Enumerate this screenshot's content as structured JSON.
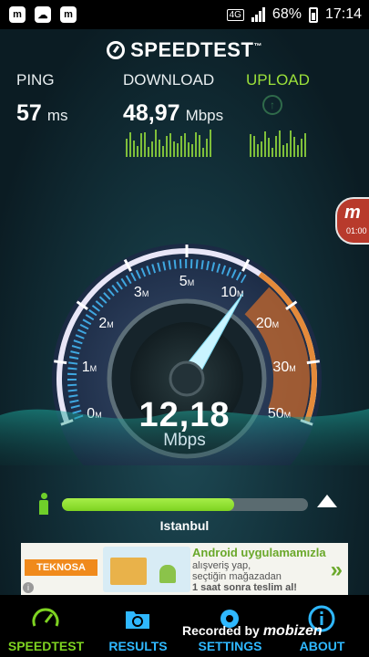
{
  "status_bar": {
    "network": "4G",
    "battery": "68%",
    "time": "17:14",
    "notification_icons": [
      "mobizen-icon",
      "cloud-upload-icon",
      "mobizen-icon"
    ]
  },
  "app": {
    "title": "SPEEDTEST",
    "trademark": "™"
  },
  "metrics": {
    "ping_label": "PING",
    "ping_value": "57",
    "ping_unit": "ms",
    "download_label": "DOWNLOAD",
    "download_value": "48,97",
    "download_unit": "Mbps",
    "upload_label": "UPLOAD"
  },
  "gauge": {
    "ticks": [
      "0",
      "1",
      "2",
      "3",
      "5",
      "10",
      "20",
      "30",
      "50"
    ],
    "tick_suffix": "M",
    "current_speed": "12,18",
    "unit": "Mbps",
    "needle_value": 12.18
  },
  "server": {
    "progress_fraction": 0.7,
    "city": "Istanbul"
  },
  "ad": {
    "brand": "TEKNOSA",
    "line1": "Android uygulamamızla",
    "line2": "alışveriş yap,",
    "line3": "seçtiğin mağazadan",
    "line4": "1 saat sonra teslim al!",
    "arrow": "»"
  },
  "overlay": {
    "mobizen_letter": "m",
    "mobizen_timer": "01:00",
    "recorded_by": "Recorded by",
    "recorder_brand": "mobizen"
  },
  "tabs": [
    {
      "label": "SPEEDTEST",
      "icon": "speedometer-icon",
      "active": true
    },
    {
      "label": "RESULTS",
      "icon": "folder-icon",
      "active": false
    },
    {
      "label": "SETTINGS",
      "icon": "gear-icon",
      "active": false
    },
    {
      "label": "ABOUT",
      "icon": "info-icon",
      "active": false
    }
  ],
  "colors": {
    "accent_green": "#7ed321",
    "tab_blue": "#2fb8ff",
    "gauge_orange": "#e07a2a"
  }
}
